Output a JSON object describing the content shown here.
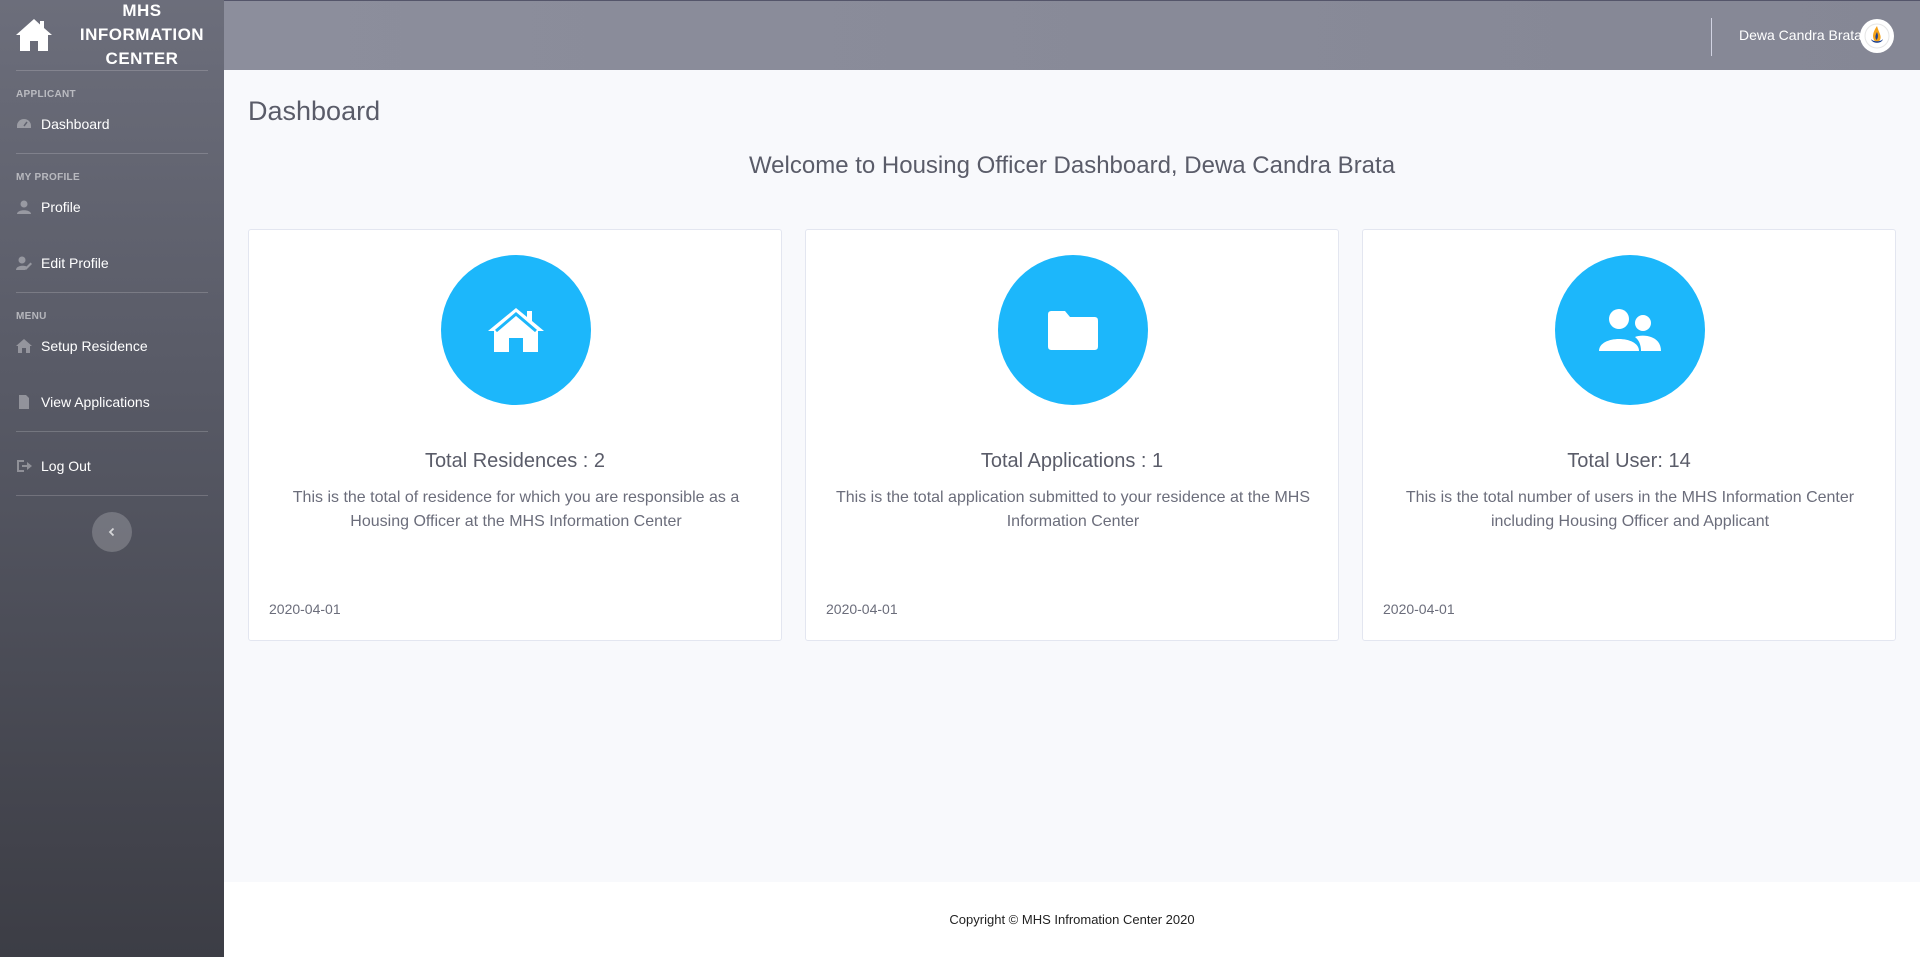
{
  "app": {
    "title": "MHS INFORMATION CENTER"
  },
  "sidebar": {
    "sections": [
      {
        "heading": "APPLICANT"
      },
      {
        "heading": "MY PROFILE"
      },
      {
        "heading": "MENU"
      }
    ],
    "items": {
      "dashboard": {
        "label": "Dashboard",
        "icon": "tachometer-icon"
      },
      "profile": {
        "label": "Profile",
        "icon": "user-icon"
      },
      "edit_profile": {
        "label": "Edit Profile",
        "icon": "user-edit-icon"
      },
      "setup_residence": {
        "label": "Setup Residence",
        "icon": "home-icon"
      },
      "view_applications": {
        "label": "View Applications",
        "icon": "file-icon"
      },
      "logout": {
        "label": "Log Out",
        "icon": "sign-out-icon"
      }
    }
  },
  "topbar": {
    "user_name": "Dewa Candra Brata"
  },
  "main": {
    "page_title": "Dashboard",
    "welcome": "Welcome to Housing Officer Dashboard, Dewa Candra Brata",
    "cards": [
      {
        "title": "Total Residences : 2",
        "description": "This is the total of residence for which you are responsible as a Housing Officer at the MHS Information Center",
        "date": "2020-04-01",
        "icon": "home-icon"
      },
      {
        "title": "Total Applications : 1",
        "description": "This is the total application submitted to your residence at the MHS Information Center",
        "date": "2020-04-01",
        "icon": "folder-icon"
      },
      {
        "title": "Total User: 14",
        "description": "This is the total number of users in the MHS Information Center including Housing Officer and Applicant",
        "date": "2020-04-01",
        "icon": "users-icon"
      }
    ]
  },
  "footer": {
    "copyright": "Copyright © MHS Infromation Center 2020"
  },
  "colors": {
    "accent": "#1cb7fb",
    "sidebar": "#585a66",
    "topbar": "#858795"
  }
}
